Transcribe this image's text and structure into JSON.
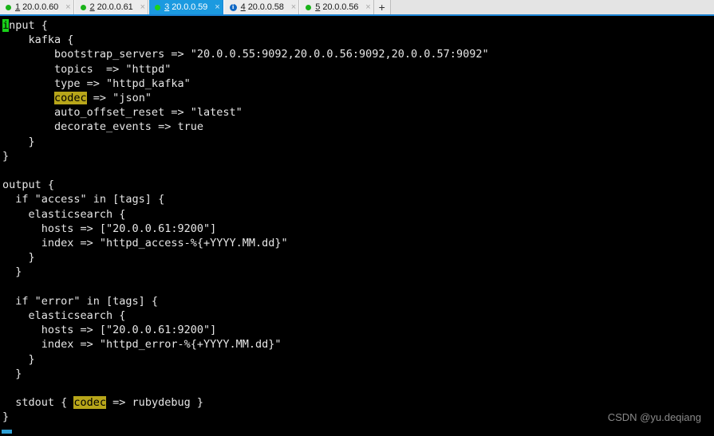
{
  "window": {
    "type": "terminal-emulator",
    "background": "#000000",
    "text_color": "#e6e6e6",
    "accent": "#1b9ae0"
  },
  "tabbar": {
    "accent_line_color": "#1b82d2",
    "background": "#e4e4e4",
    "add_tab_label": "+",
    "close_glyph": "×",
    "tabs": [
      {
        "number": "1",
        "host": "20.0.0.60",
        "status_icon": "green-dot-icon",
        "status": "connected",
        "active": false
      },
      {
        "number": "2",
        "host": "20.0.0.61",
        "status_icon": "green-dot-icon",
        "status": "connected",
        "active": false
      },
      {
        "number": "3",
        "host": "20.0.0.59",
        "status_icon": "green-dot-icon",
        "status": "connected",
        "active": true
      },
      {
        "number": "4",
        "host": "20.0.0.58",
        "status_icon": "blue-info-icon",
        "status": "info",
        "active": false
      },
      {
        "number": "5",
        "host": "20.0.0.56",
        "status_icon": "green-dot-icon",
        "status": "connected",
        "active": false
      }
    ]
  },
  "terminal": {
    "cursor": {
      "char": "i",
      "color": "#19d219",
      "text_color": "#000000"
    },
    "highlight_color": "#b8a61a",
    "highlighted_words": [
      "codec",
      "codec"
    ],
    "config_text": "input {\n    kafka {\n        bootstrap_servers => \"20.0.0.55:9092,20.0.0.56:9092,20.0.0.57:9092\"\n        topics  => \"httpd\"\n        type => \"httpd_kafka\"\n        codec => \"json\"\n        auto_offset_reset => \"latest\"\n        decorate_events => true\n    }\n}\n\noutput {\n  if \"access\" in [tags] {\n    elasticsearch {\n      hosts => [\"20.0.0.61:9200\"]\n      index => \"httpd_access-%{+YYYY.MM.dd}\"\n    }\n  }\n\n  if \"error\" in [tags] {\n    elasticsearch {\n      hosts => [\"20.0.0.61:9200\"]\n      index => \"httpd_error-%{+YYYY.MM.dd}\"\n    }\n  }\n\n  stdout { codec => rubydebug }\n}",
    "lines": [
      "input {",
      "    kafka {",
      "        bootstrap_servers => \"20.0.0.55:9092,20.0.0.56:9092,20.0.0.57:9092\"",
      "        topics  => \"httpd\"",
      "        type => \"httpd_kafka\"",
      "        codec => \"json\"",
      "        auto_offset_reset => \"latest\"",
      "        decorate_events => true",
      "    }",
      "}",
      "",
      "output {",
      "  if \"access\" in [tags] {",
      "    elasticsearch {",
      "      hosts => [\"20.0.0.61:9200\"]",
      "      index => \"httpd_access-%{+YYYY.MM.dd}\"",
      "    }",
      "  }",
      "",
      "  if \"error\" in [tags] {",
      "    elasticsearch {",
      "      hosts => [\"20.0.0.61:9200\"]",
      "      index => \"httpd_error-%{+YYYY.MM.dd}\"",
      "    }",
      "  }",
      "",
      "  stdout { codec => rubydebug }",
      "}"
    ]
  },
  "watermark": {
    "text": "CSDN @yu.deqiang"
  }
}
